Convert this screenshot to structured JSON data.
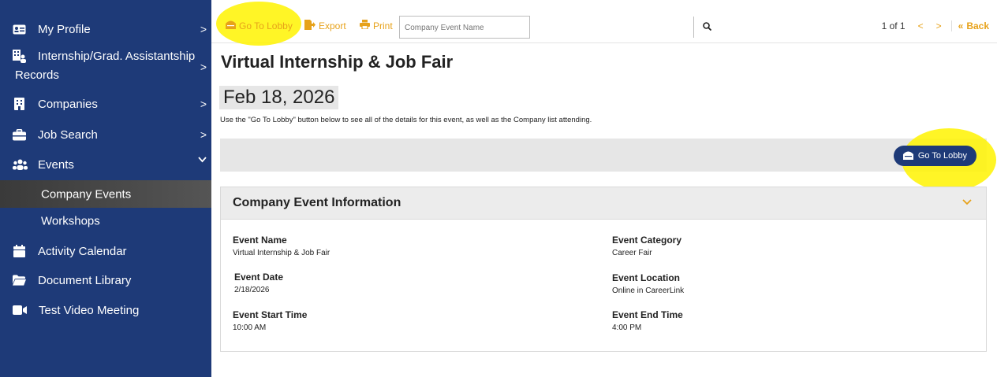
{
  "sidebar": {
    "items": [
      {
        "label": "My Profile",
        "icon": "id-card-icon",
        "chevron": ">"
      },
      {
        "label": "Internship/Grad. Assistantship",
        "label2": "Records",
        "icon": "records-icon",
        "chevron": ">"
      },
      {
        "label": "Companies",
        "icon": "building-icon",
        "chevron": ">"
      },
      {
        "label": "Job Search",
        "icon": "briefcase-icon",
        "chevron": ">"
      },
      {
        "label": "Events",
        "icon": "users-icon",
        "chevron": "⌄"
      },
      {
        "label": "Activity Calendar",
        "icon": "calendar-icon"
      },
      {
        "label": "Document Library",
        "icon": "folder-icon"
      },
      {
        "label": "Test Video Meeting",
        "icon": "video-icon"
      }
    ],
    "subitems": [
      {
        "label": "Company Events",
        "active": true
      },
      {
        "label": "Workshops",
        "active": false
      }
    ]
  },
  "toolbar": {
    "go_to_lobby": "Go To Lobby",
    "export": "Export",
    "print": "Print",
    "search_placeholder": "Company Event Name",
    "page_info": "1 of 1",
    "prev": "<",
    "next": ">",
    "back": "Back"
  },
  "main": {
    "title": "Virtual Internship & Job Fair",
    "date": "Feb 18, 2026",
    "description": "Use the \"Go To Lobby\" button below to see all of the details for this event, as well as the Company list attending.",
    "lobby_button": "Go To Lobby"
  },
  "card": {
    "title": "Company Event Information",
    "fields": [
      {
        "label": "Event Name",
        "value": "Virtual Internship & Job Fair"
      },
      {
        "label": "Event Category",
        "value": "Career Fair"
      },
      {
        "label": "Event Date",
        "value": "2/18/2026"
      },
      {
        "label": "Event Location",
        "value": "Online in CareerLink"
      },
      {
        "label": "Event Start Time",
        "value": "10:00 AM"
      },
      {
        "label": "Event End Time",
        "value": "4:00 PM"
      }
    ]
  },
  "colors": {
    "sidebar_bg": "#1e3a78",
    "accent": "#e7a21a",
    "highlight": "#fff300"
  }
}
